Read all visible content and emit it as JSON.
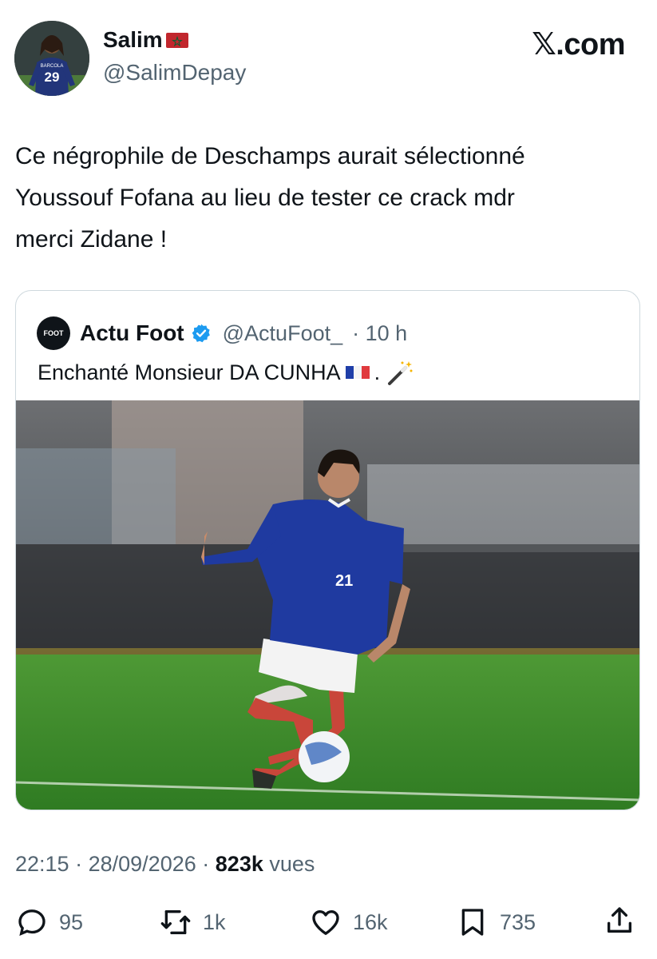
{
  "user": {
    "name": "Salim",
    "handle": "@SalimDepay",
    "avatar_jersey": "29",
    "avatar_jersey_name": "BARCOLA"
  },
  "brand": "𝕏.com",
  "tweet": {
    "text": "Ce négrophile de Deschamps aurait sélectionné\nYoussouf Fofana au lieu de tester ce crack mdr\nmerci Zidane !"
  },
  "quote": {
    "logo_text": "FOOT",
    "name": "Actu Foot",
    "verified": true,
    "handle": "@ActuFoot_",
    "time": "· 10 h",
    "text": "Enchanté Monsieur DA CUNHA",
    "text_suffix": ".",
    "photo_number": "21"
  },
  "meta": {
    "time": "22:15",
    "sep1": "·",
    "date": "28/09/2026",
    "sep2": "·",
    "views_count": "823k",
    "views_label": "vues"
  },
  "actions": {
    "replies": "95",
    "reposts": "1k",
    "likes": "16k",
    "bookmarks": "735"
  },
  "colors": {
    "text": "#0f1419",
    "secondary": "#536471",
    "border": "#cfd9de",
    "verified": "#1d9bf0",
    "jersey": "#1e3a8a",
    "pitch": "#3f8f2e"
  },
  "icons": [
    "reply-icon",
    "repost-icon",
    "like-icon",
    "bookmark-icon",
    "share-icon",
    "verified-badge-icon",
    "magic-wand-icon",
    "flag-morocco-icon",
    "flag-france-icon"
  ]
}
